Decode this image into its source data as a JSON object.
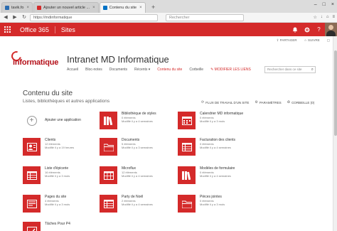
{
  "browser": {
    "tabs": [
      {
        "label": "tavik.fo",
        "favicon_color": "#2b6cb0",
        "active": false
      },
      {
        "label": "Ajouter un nouvel article ...",
        "favicon_color": "#d42a2a",
        "active": false
      },
      {
        "label": "Contenu du site",
        "favicon_color": "#0072c6",
        "active": true
      }
    ],
    "url": "https://mdinformatique",
    "search_placeholder": "Rechercher"
  },
  "suite": {
    "app_name": "Office 365",
    "section": "Sites"
  },
  "share_row": {
    "share": "PARTAGER",
    "follow": "SUIVRE"
  },
  "site": {
    "logo_text": "informatique",
    "title": "Intranet MD Informatique",
    "nav": [
      "Accueil",
      "Bloc-notes",
      "Documents",
      "Récents",
      "Contenu du site",
      "Corbeille"
    ],
    "current_nav": "Contenu du site",
    "edit_links": "MODIFIER LES LIENS",
    "search_placeholder": "Rechercher dans ce site"
  },
  "page": {
    "title": "Contenu du site",
    "subtitle": "Listes, bibliothèques et autres applications",
    "actions": {
      "workflow": "FLUX DE TRAVAIL D'UN SITE",
      "settings": "PARAMÈTRES",
      "recycle": "CORBEILLE (0)"
    }
  },
  "tiles": [
    {
      "name": "Ajouter une application",
      "items": "",
      "modified": "",
      "icon": "add-icon"
    },
    {
      "name": "Bibliothèque de styles",
      "items": "0 éléments",
      "modified": "Modifié il y a 4 semaines",
      "icon": "library-icon"
    },
    {
      "name": "Calendrier MD informatique",
      "items": "0 éléments",
      "modified": "Modifié il y a 3 mois",
      "icon": "calendar-icon"
    },
    {
      "name": "Clients",
      "items": "12 éléments",
      "modified": "Modifié il y a 19 heures",
      "icon": "contacts-icon"
    },
    {
      "name": "Documents",
      "items": "5 éléments",
      "modified": "Modifié il y a 3 semaines",
      "icon": "documents-icon"
    },
    {
      "name": "Facturation des clients",
      "items": "0 éléments",
      "modified": "Modifié il y a 4 semaines",
      "icon": "list-icon"
    },
    {
      "name": "Liste d'épicerie",
      "items": "16 éléments",
      "modified": "Modifié il y a 3 mois",
      "icon": "list-icon"
    },
    {
      "name": "Microflux",
      "items": "12 éléments",
      "modified": "Modifié il y a 4 semaines",
      "icon": "table-icon"
    },
    {
      "name": "Modèles de formulaire",
      "items": "0 éléments",
      "modified": "Modifié il y a 4 semaines",
      "icon": "library-icon"
    },
    {
      "name": "Pages du site",
      "items": "4 éléments",
      "modified": "Modifié il y a 3 mois",
      "icon": "pages-icon"
    },
    {
      "name": "Party de Noël",
      "items": "2 éléments",
      "modified": "Modifié il y a 4 semaines",
      "icon": "list-icon"
    },
    {
      "name": "Pièces jointes",
      "items": "0 éléments",
      "modified": "Modifié il y a 3 mois",
      "icon": "documents-icon"
    },
    {
      "name": "Tâches Pour P4",
      "items": "",
      "modified": "",
      "icon": "tasks-icon"
    }
  ]
}
